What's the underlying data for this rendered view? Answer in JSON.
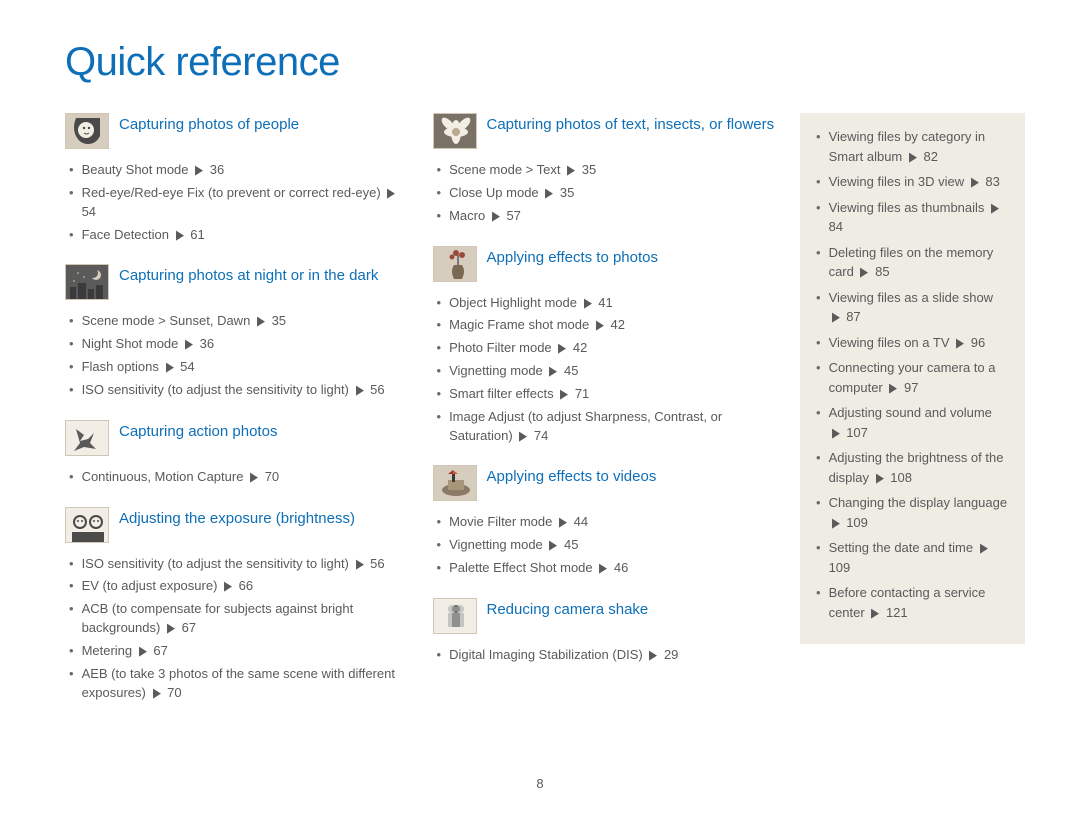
{
  "page_title": "Quick reference",
  "page_number": "8",
  "columns": {
    "left": [
      {
        "title": "Capturing photos of people",
        "icon": "face-icon",
        "items": [
          {
            "text": "Beauty Shot mode",
            "page": "36"
          },
          {
            "text": "Red-eye/Red-eye Fix (to prevent or correct red-eye)",
            "page": "54"
          },
          {
            "text": "Face Detection",
            "page": "61"
          }
        ]
      },
      {
        "title": "Capturing photos at night or in the dark",
        "icon": "night-icon",
        "items": [
          {
            "text": "Scene mode > Sunset, Dawn",
            "page": "35"
          },
          {
            "text": "Night Shot mode",
            "page": "36"
          },
          {
            "text": "Flash options",
            "page": "54"
          },
          {
            "text": "ISO sensitivity (to adjust the sensitivity to light)",
            "page": "56"
          }
        ]
      },
      {
        "title": "Capturing action photos",
        "icon": "action-icon",
        "items": [
          {
            "text": "Continuous, Motion Capture",
            "page": "70"
          }
        ]
      },
      {
        "title": "Adjusting the exposure (brightness)",
        "icon": "exposure-icon",
        "items": [
          {
            "text": "ISO sensitivity (to adjust the sensitivity to light)",
            "page": "56"
          },
          {
            "text": "EV (to adjust exposure)",
            "page": "66"
          },
          {
            "text": "ACB (to compensate for subjects against bright backgrounds)",
            "page": "67"
          },
          {
            "text": "Metering",
            "page": "67"
          },
          {
            "text": "AEB (to take 3 photos of the same scene with different exposures)",
            "page": "70"
          }
        ]
      }
    ],
    "middle": [
      {
        "title": "Capturing  photos of text, insects, or flowers",
        "icon": "flower-icon",
        "items": [
          {
            "text": "Scene mode > Text",
            "page": "35"
          },
          {
            "text": "Close Up mode",
            "page": "35"
          },
          {
            "text": "Macro",
            "page": "57"
          }
        ]
      },
      {
        "title": "Applying effects to photos",
        "icon": "vase-icon",
        "items": [
          {
            "text": "Object Highlight mode",
            "page": "41"
          },
          {
            "text": "Magic Frame shot mode",
            "page": "42"
          },
          {
            "text": "Photo Filter mode",
            "page": "42"
          },
          {
            "text": "Vignetting mode",
            "page": "45"
          },
          {
            "text": "Smart filter effects",
            "page": "71"
          },
          {
            "text": "Image Adjust (to adjust Sharpness, Contrast, or Saturation)",
            "page": "74"
          }
        ]
      },
      {
        "title": "Applying effects to videos",
        "icon": "video-icon",
        "items": [
          {
            "text": "Movie Filter mode",
            "page": "44"
          },
          {
            "text": "Vignetting mode",
            "page": "45"
          },
          {
            "text": "Palette Effect Shot mode",
            "page": "46"
          }
        ]
      },
      {
        "title": "Reducing camera shake",
        "icon": "shake-icon",
        "items": [
          {
            "text": "Digital Imaging Stabilization (DIS)",
            "page": "29"
          }
        ]
      }
    ],
    "right": [
      {
        "text": "Viewing files by category in Smart album",
        "page": "82"
      },
      {
        "text": "Viewing files in 3D view",
        "page": "83"
      },
      {
        "text": "Viewing files as thumbnails",
        "page": "84"
      },
      {
        "text": "Deleting files on the memory card",
        "page": "85"
      },
      {
        "text": "Viewing files as a slide show",
        "page": "87"
      },
      {
        "text": "Viewing files on a TV",
        "page": "96"
      },
      {
        "text": "Connecting your camera to a computer",
        "page": "97"
      },
      {
        "text": "Adjusting sound and volume",
        "page": "107"
      },
      {
        "text": "Adjusting the brightness of the display",
        "page": "108"
      },
      {
        "text": "Changing the display language",
        "page": "109"
      },
      {
        "text": "Setting the date and time",
        "page": "109"
      },
      {
        "text": "Before contacting a service center",
        "page": "121"
      }
    ]
  }
}
